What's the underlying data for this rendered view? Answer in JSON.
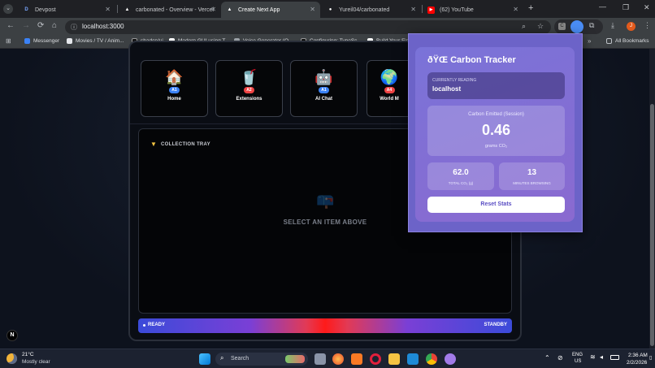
{
  "tabs": [
    {
      "icon": "D",
      "title": "Devpost"
    },
    {
      "icon": "▲",
      "title": "carbonated - Overview - Vercel"
    },
    {
      "icon": "▲",
      "title": "Create Next App"
    },
    {
      "icon": "●",
      "title": "Yureil04/carbonated"
    },
    {
      "icon": "▶",
      "title": "(62) YouTube"
    }
  ],
  "address": "localhost:3000",
  "bookmarks": [
    "Messenger",
    "Movies / TV / Anim...",
    "shadcn/ui",
    "Modern GUI using T...",
    "Voice Generator (O...",
    "Configuring: TypeSc...",
    "Build Your Firs"
  ],
  "all_bookmarks": "All Bookmarks",
  "cards": [
    {
      "icon": "🏠",
      "badge": "A1",
      "badge_color": "#3b82f6",
      "label": "Home"
    },
    {
      "icon": "🥤",
      "badge": "A2",
      "badge_color": "#ef4444",
      "label": "Extensions"
    },
    {
      "icon": "🤖",
      "badge": "A1",
      "badge_color": "#3b82f6",
      "label": "AI Chat"
    },
    {
      "icon": "🌍",
      "badge": "A4",
      "badge_color": "#ef4444",
      "label": "World M"
    }
  ],
  "tray": {
    "title": "COLLECTION TRAY",
    "empty": "SELECT AN ITEM ABOVE"
  },
  "status": {
    "left": "READY",
    "right": "STANDBY"
  },
  "popup": {
    "title": "ðŸŒ Carbon Tracker",
    "reading_label": "CURRENTLY READING",
    "reading_value": "localhost",
    "emitted_label": "Carbon Emitted (Session)",
    "emitted_value": "0.46",
    "emitted_unit": "grams CO₂",
    "total_value": "62.0",
    "total_label": "TOTAL CO₂ (g)",
    "minutes_value": "13",
    "minutes_label": "MINUTES BROWSING",
    "reset": "Reset Stats"
  },
  "weather": {
    "temp": "21°C",
    "desc": "Mostly clear"
  },
  "search": "Search",
  "tray_lang": {
    "l1": "ENG",
    "l2": "US"
  },
  "clock": {
    "time": "2:36 AM",
    "date": "2/2/2026"
  },
  "next_badge": "N"
}
